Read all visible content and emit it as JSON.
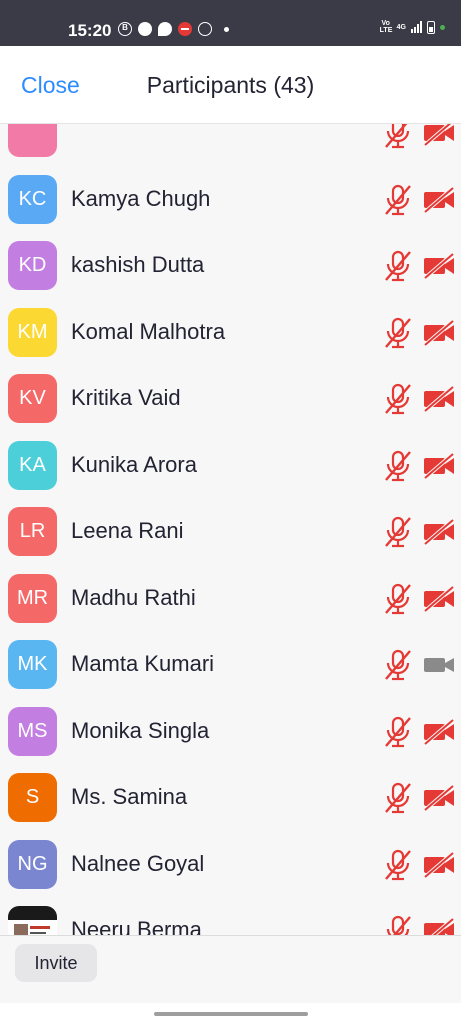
{
  "status_bar": {
    "time": "15:20",
    "left_icons": [
      "b-circle-icon",
      "chat-bubble-icon",
      "location-bolt-icon",
      "do-not-disturb-icon",
      "telegram-icon",
      "notification-dot-icon"
    ],
    "network_label": "4G",
    "volte_label": "Vo LTE"
  },
  "header": {
    "close_label": "Close",
    "title": "Participants (43)"
  },
  "colors": {
    "accent": "#2d8cff",
    "muted_red": "#e53935",
    "video_on_gray": "#8a8a8a"
  },
  "participants": [
    {
      "initials": "",
      "name": "",
      "avatar_color": "#f27aa6",
      "mic": "muted",
      "video": "off"
    },
    {
      "initials": "KC",
      "name": "Kamya Chugh",
      "avatar_color": "#5aa9f5",
      "mic": "muted",
      "video": "off"
    },
    {
      "initials": "KD",
      "name": "kashish Dutta",
      "avatar_color": "#c27ee0",
      "mic": "muted",
      "video": "off"
    },
    {
      "initials": "KM",
      "name": "Komal Malhotra",
      "avatar_color": "#fbd832",
      "mic": "muted",
      "video": "off"
    },
    {
      "initials": "KV",
      "name": "Kritika Vaid",
      "avatar_color": "#f56868",
      "mic": "muted",
      "video": "off"
    },
    {
      "initials": "KA",
      "name": "Kunika Arora",
      "avatar_color": "#4ccfd8",
      "mic": "muted",
      "video": "off"
    },
    {
      "initials": "LR",
      "name": "Leena Rani",
      "avatar_color": "#f56868",
      "mic": "muted",
      "video": "off"
    },
    {
      "initials": "MR",
      "name": "Madhu Rathi",
      "avatar_color": "#f56868",
      "mic": "muted",
      "video": "off"
    },
    {
      "initials": "MK",
      "name": "Mamta Kumari",
      "avatar_color": "#5ab6f0",
      "mic": "muted",
      "video": "on"
    },
    {
      "initials": "MS",
      "name": "Monika Singla",
      "avatar_color": "#c27ee0",
      "mic": "muted",
      "video": "off"
    },
    {
      "initials": "S",
      "name": "Ms. Samina",
      "avatar_color": "#ef6c00",
      "mic": "muted",
      "video": "off"
    },
    {
      "initials": "NG",
      "name": "Nalnee Goyal",
      "avatar_color": "#7b86d1",
      "mic": "muted",
      "video": "off"
    },
    {
      "initials": "",
      "name": "Neeru Berma",
      "avatar_color": "#ffffff",
      "avatar_type": "photo",
      "mic": "muted",
      "video": "off"
    }
  ],
  "footer": {
    "invite_label": "Invite"
  }
}
